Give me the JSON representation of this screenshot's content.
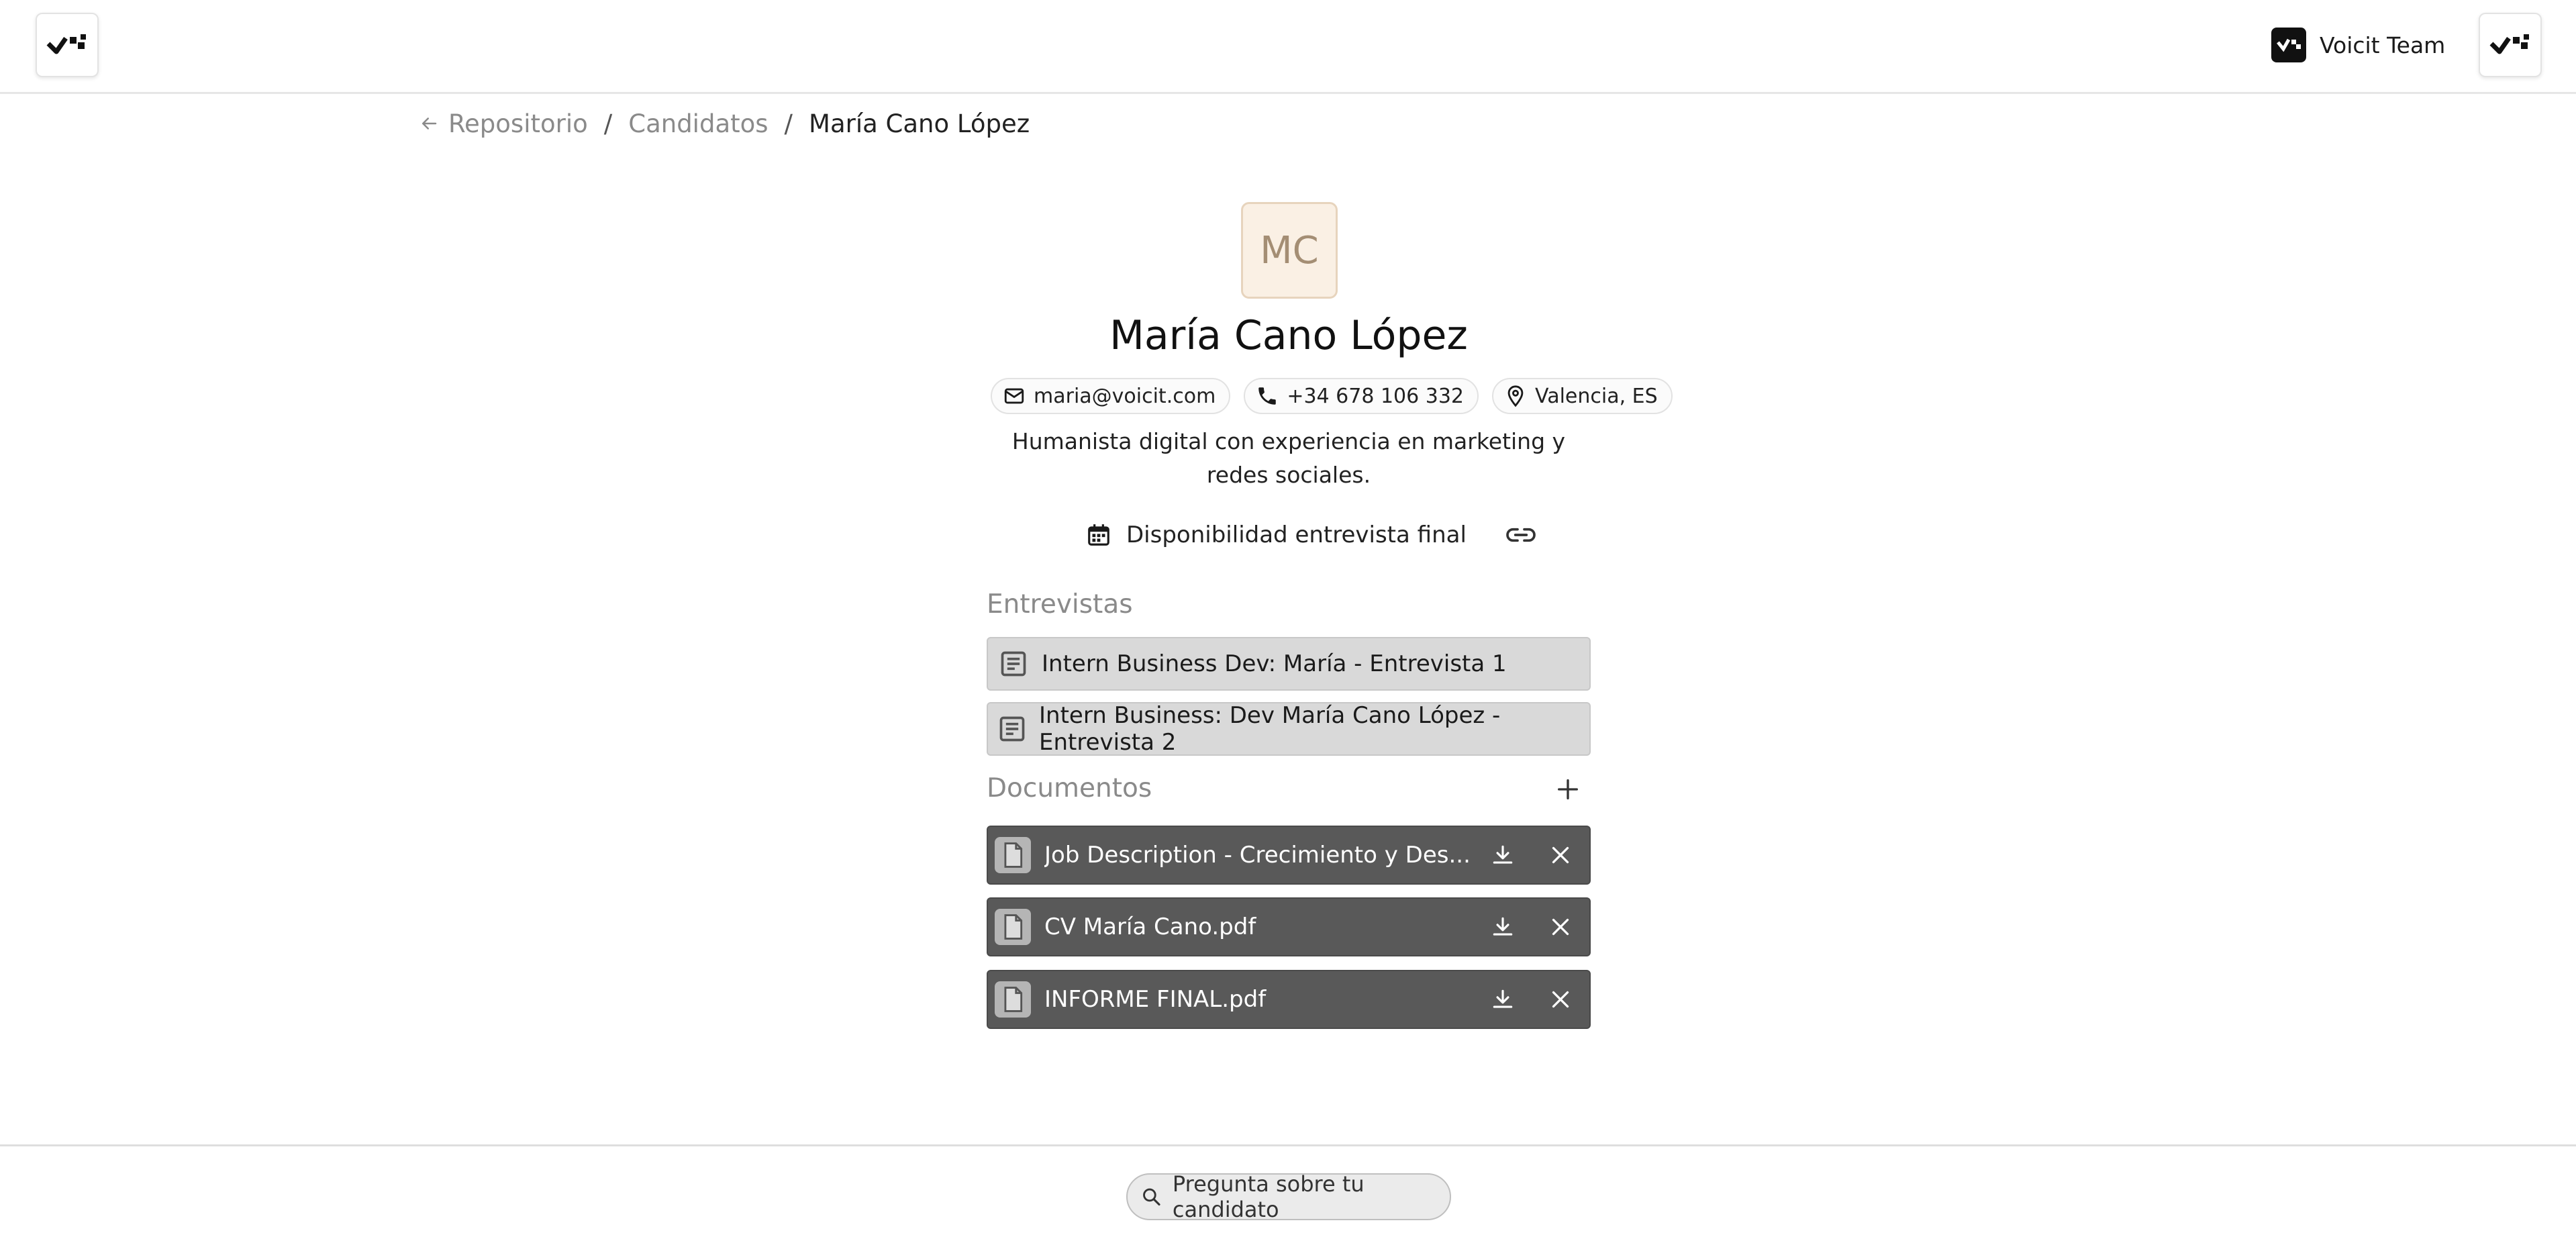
{
  "team": {
    "name": "Voicit Team"
  },
  "breadcrumb": {
    "items": [
      "Repositorio",
      "Candidatos",
      "María Cano López"
    ],
    "separator": "/"
  },
  "candidate": {
    "initials": "MC",
    "name": "María Cano López",
    "email": "maria@voicit.com",
    "phone": "+34 678 106 332",
    "location": "Valencia, ES",
    "bio": "Humanista digital con experiencia en marketing y redes sociales."
  },
  "availability": {
    "label": "Disponibilidad entrevista final"
  },
  "interviews": {
    "title": "Entrevistas",
    "items": [
      "Intern Business Dev: María - Entrevista 1",
      "Intern Business: Dev María Cano López - Entrevista 2"
    ]
  },
  "documents": {
    "title": "Documentos",
    "items": [
      "Job Description - Crecimiento y Des...",
      "CV María Cano.pdf",
      "INFORME FINAL.pdf"
    ]
  },
  "assistant": {
    "placeholder": "Pregunta sobre tu candidato"
  },
  "colors": {
    "avatar_bg": "#faf0e4",
    "interview_bg": "#d9d9d9",
    "document_bg": "#595959"
  }
}
